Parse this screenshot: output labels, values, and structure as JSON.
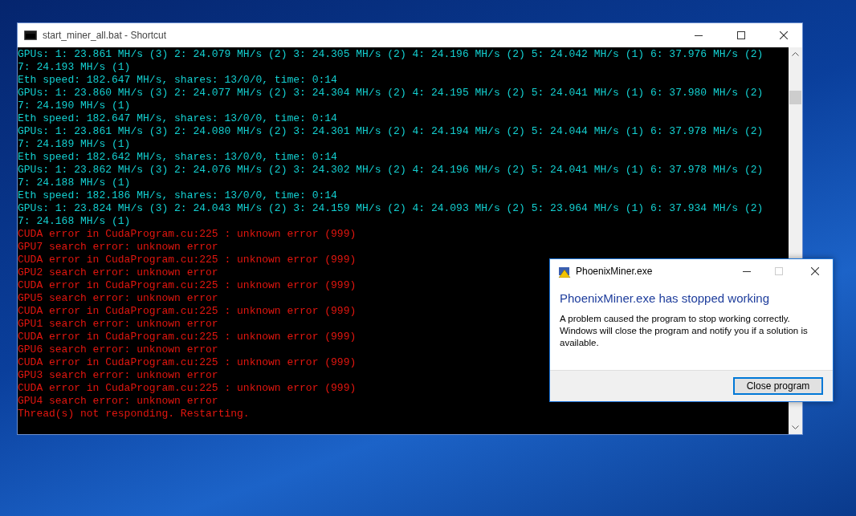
{
  "console": {
    "title": "start_miner_all.bat - Shortcut",
    "lines": [
      {
        "kind": "info",
        "text": "GPUs: 1: 23.861 MH/s (3) 2: 24.079 MH/s (2) 3: 24.305 MH/s (2) 4: 24.196 MH/s (2) 5: 24.042 MH/s (1) 6: 37.976 MH/s (2)"
      },
      {
        "kind": "info",
        "text": "7: 24.193 MH/s (1)"
      },
      {
        "kind": "info",
        "text": "Eth speed: 182.647 MH/s, shares: 13/0/0, time: 0:14"
      },
      {
        "kind": "info",
        "text": "GPUs: 1: 23.860 MH/s (3) 2: 24.077 MH/s (2) 3: 24.304 MH/s (2) 4: 24.195 MH/s (2) 5: 24.041 MH/s (1) 6: 37.980 MH/s (2)"
      },
      {
        "kind": "info",
        "text": "7: 24.190 MH/s (1)"
      },
      {
        "kind": "info",
        "text": "Eth speed: 182.647 MH/s, shares: 13/0/0, time: 0:14"
      },
      {
        "kind": "info",
        "text": "GPUs: 1: 23.861 MH/s (3) 2: 24.080 MH/s (2) 3: 24.301 MH/s (2) 4: 24.194 MH/s (2) 5: 24.044 MH/s (1) 6: 37.978 MH/s (2)"
      },
      {
        "kind": "info",
        "text": "7: 24.189 MH/s (1)"
      },
      {
        "kind": "info",
        "text": "Eth speed: 182.642 MH/s, shares: 13/0/0, time: 0:14"
      },
      {
        "kind": "info",
        "text": "GPUs: 1: 23.862 MH/s (3) 2: 24.076 MH/s (2) 3: 24.302 MH/s (2) 4: 24.196 MH/s (2) 5: 24.041 MH/s (1) 6: 37.978 MH/s (2)"
      },
      {
        "kind": "info",
        "text": "7: 24.188 MH/s (1)"
      },
      {
        "kind": "info",
        "text": "Eth speed: 182.186 MH/s, shares: 13/0/0, time: 0:14"
      },
      {
        "kind": "info",
        "text": "GPUs: 1: 23.824 MH/s (3) 2: 24.043 MH/s (2) 3: 24.159 MH/s (2) 4: 24.093 MH/s (2) 5: 23.964 MH/s (1) 6: 37.934 MH/s (2)"
      },
      {
        "kind": "info",
        "text": "7: 24.168 MH/s (1)"
      },
      {
        "kind": "error",
        "text": "CUDA error in CudaProgram.cu:225 : unknown error (999)"
      },
      {
        "kind": "error",
        "text": "GPU7 search error: unknown error"
      },
      {
        "kind": "error",
        "text": "CUDA error in CudaProgram.cu:225 : unknown error (999)"
      },
      {
        "kind": "error",
        "text": "GPU2 search error: unknown error"
      },
      {
        "kind": "error",
        "text": "CUDA error in CudaProgram.cu:225 : unknown error (999)"
      },
      {
        "kind": "error",
        "text": "GPU5 search error: unknown error"
      },
      {
        "kind": "error",
        "text": "CUDA error in CudaProgram.cu:225 : unknown error (999)"
      },
      {
        "kind": "error",
        "text": "GPU1 search error: unknown error"
      },
      {
        "kind": "error",
        "text": "CUDA error in CudaProgram.cu:225 : unknown error (999)"
      },
      {
        "kind": "error",
        "text": "GPU6 search error: unknown error"
      },
      {
        "kind": "error",
        "text": "CUDA error in CudaProgram.cu:225 : unknown error (999)"
      },
      {
        "kind": "error",
        "text": "GPU3 search error: unknown error"
      },
      {
        "kind": "error",
        "text": "CUDA error in CudaProgram.cu:225 : unknown error (999)"
      },
      {
        "kind": "error",
        "text": "GPU4 search error: unknown error"
      },
      {
        "kind": "error",
        "text": "Thread(s) not responding. Restarting."
      }
    ]
  },
  "dialog": {
    "title": "PhoenixMiner.exe",
    "heading": "PhoenixMiner.exe has stopped working",
    "message": "A problem caused the program to stop working correctly. Windows will close the program and notify you if a solution is available.",
    "buttons": [
      {
        "label": "Close program",
        "focused": true
      }
    ]
  }
}
